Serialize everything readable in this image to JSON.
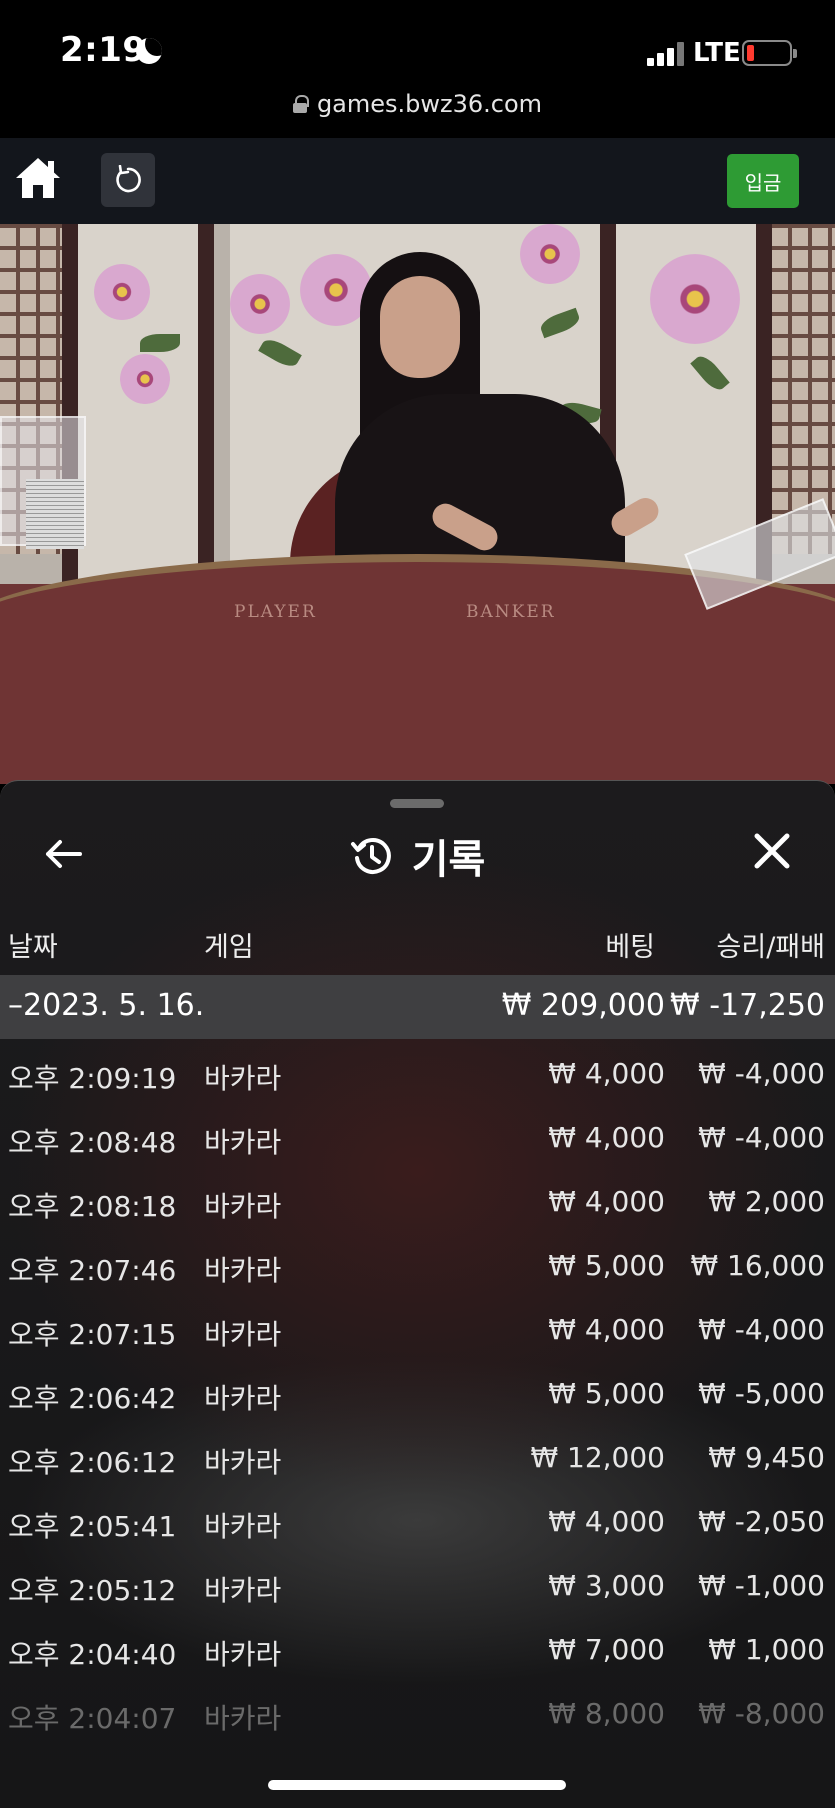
{
  "status_bar": {
    "time": "2:19",
    "network": "LTE"
  },
  "browser": {
    "url": "games.bwz36.com"
  },
  "toolbar": {
    "deposit_label": "입금"
  },
  "video": {
    "table_labels": [
      "PLAYER",
      "BANKER"
    ]
  },
  "history": {
    "title": "기록",
    "columns": {
      "date": "날짜",
      "game": "게임",
      "bet": "베팅",
      "win_loss": "승리/패배"
    },
    "summary": {
      "date": "–2023. 5. 16.",
      "bet": "₩ 209,000",
      "win_loss": "₩ -17,250"
    },
    "rows": [
      {
        "time": "오후 2:09:19",
        "game": "바카라",
        "bet": "₩ 4,000",
        "win_loss": "₩ -4,000"
      },
      {
        "time": "오후 2:08:48",
        "game": "바카라",
        "bet": "₩ 4,000",
        "win_loss": "₩ -4,000"
      },
      {
        "time": "오후 2:08:18",
        "game": "바카라",
        "bet": "₩ 4,000",
        "win_loss": "₩ 2,000"
      },
      {
        "time": "오후 2:07:46",
        "game": "바카라",
        "bet": "₩ 5,000",
        "win_loss": "₩ 16,000"
      },
      {
        "time": "오후 2:07:15",
        "game": "바카라",
        "bet": "₩ 4,000",
        "win_loss": "₩ -4,000"
      },
      {
        "time": "오후 2:06:42",
        "game": "바카라",
        "bet": "₩ 5,000",
        "win_loss": "₩ -5,000"
      },
      {
        "time": "오후 2:06:12",
        "game": "바카라",
        "bet": "₩ 12,000",
        "win_loss": "₩ 9,450"
      },
      {
        "time": "오후 2:05:41",
        "game": "바카라",
        "bet": "₩ 4,000",
        "win_loss": "₩ -2,050"
      },
      {
        "time": "오후 2:05:12",
        "game": "바카라",
        "bet": "₩ 3,000",
        "win_loss": "₩ -1,000"
      },
      {
        "time": "오후 2:04:40",
        "game": "바카라",
        "bet": "₩ 7,000",
        "win_loss": "₩ 1,000"
      },
      {
        "time": "오후 2:04:07",
        "game": "바카라",
        "bet": "₩ 8,000",
        "win_loss": "₩ -8,000"
      }
    ]
  },
  "icons": {
    "status": [
      "moon-icon",
      "signal-icon",
      "battery-icon",
      "lock-icon"
    ],
    "toolbar": [
      "home-icon",
      "reload-icon"
    ],
    "sheet": [
      "back-arrow-icon",
      "history-icon",
      "close-icon"
    ]
  },
  "colors": {
    "deposit_button": "#2e9b34",
    "summary_row": "#3f3f41",
    "battery_low": "#ff3b30"
  }
}
